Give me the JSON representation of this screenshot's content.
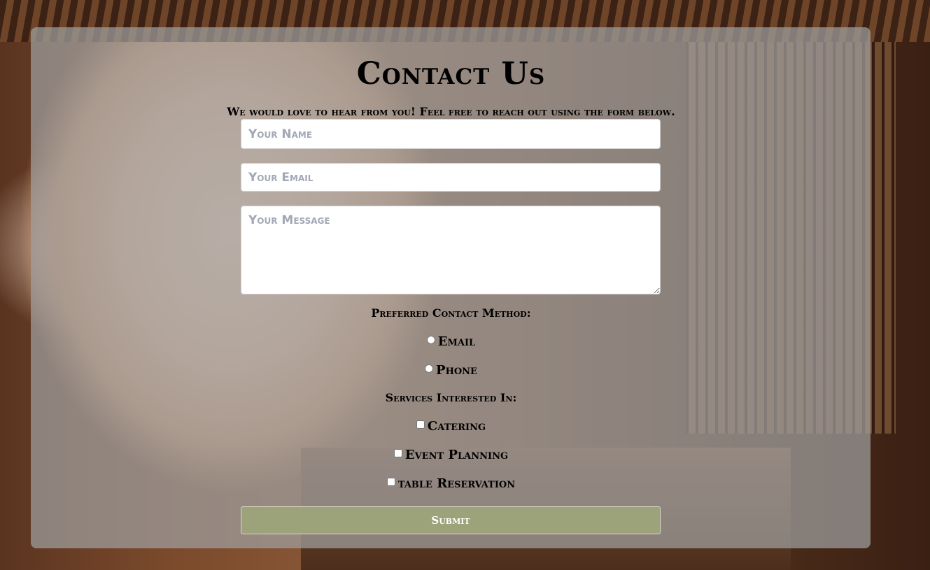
{
  "page": {
    "title": "Contact Us",
    "subtitle": "We would love to hear from you! Feel free to reach out using the form below."
  },
  "form": {
    "name_placeholder": "Your Name",
    "email_placeholder": "Your Email",
    "message_placeholder": "Your Message",
    "contact_method_label": "Preferred Contact Method:",
    "contact_methods": [
      {
        "label": "Email",
        "selected": false
      },
      {
        "label": "Phone",
        "selected": false
      }
    ],
    "services_label": "Services Interested In:",
    "services": [
      {
        "label": "Catering",
        "checked": false
      },
      {
        "label": "Event Planning",
        "checked": false
      },
      {
        "label": "table Reservation",
        "checked": false
      }
    ],
    "submit_label": "Submit"
  },
  "colors": {
    "panel": "#a0a0a0",
    "submit_button": "#9ca27a",
    "text": "#000000",
    "placeholder": "#a3a8b5"
  }
}
